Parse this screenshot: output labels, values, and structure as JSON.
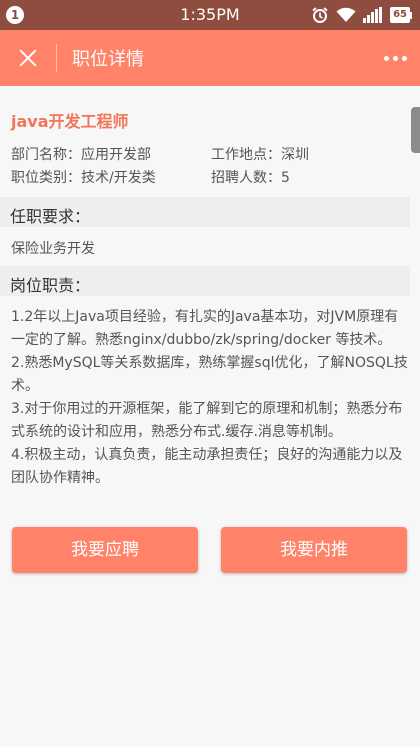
{
  "status_bar": {
    "notification_count": "1",
    "time": "1:35PM",
    "battery": "65",
    "icons": [
      "alarm-icon",
      "wifi-icon",
      "signal-icon",
      "battery-icon"
    ]
  },
  "header": {
    "title": "职位详情",
    "close_icon": "close-icon",
    "more_icon": "more-icon"
  },
  "job": {
    "title": "java开发工程师",
    "department_label": "部门名称",
    "department": "应用开发部",
    "location_label": "工作地点",
    "location": "深圳",
    "category_label": "职位类别",
    "category": "技术/开发类",
    "headcount_label": "招聘人数",
    "headcount": "5"
  },
  "requirements": {
    "heading": "任职要求：",
    "text": "保险业务开发"
  },
  "duties": {
    "heading": "岗位职责：",
    "items": [
      "1.2年以上Java项目经验，有扎实的Java基本功，对JVM原理有一定的了解。熟悉nginx/dubbo/zk/spring/docker 等技术。",
      "2.熟悉MySQL等关系数据库，熟练掌握sql优化，了解NOSQL技术。",
      "3.对于你用过的开源框架，能了解到它的原理和机制；熟悉分布式系统的设计和应用，熟悉分布式.缓存.消息等机制。",
      "4.积极主动，认真负责，能主动承担责任；良好的沟通能力以及团队协作精神。"
    ]
  },
  "actions": {
    "apply": "我要应聘",
    "refer": "我要内推"
  },
  "colors": {
    "header": "#ff8269",
    "status_bar": "#8e4d3f",
    "title_accent": "#f27559"
  }
}
